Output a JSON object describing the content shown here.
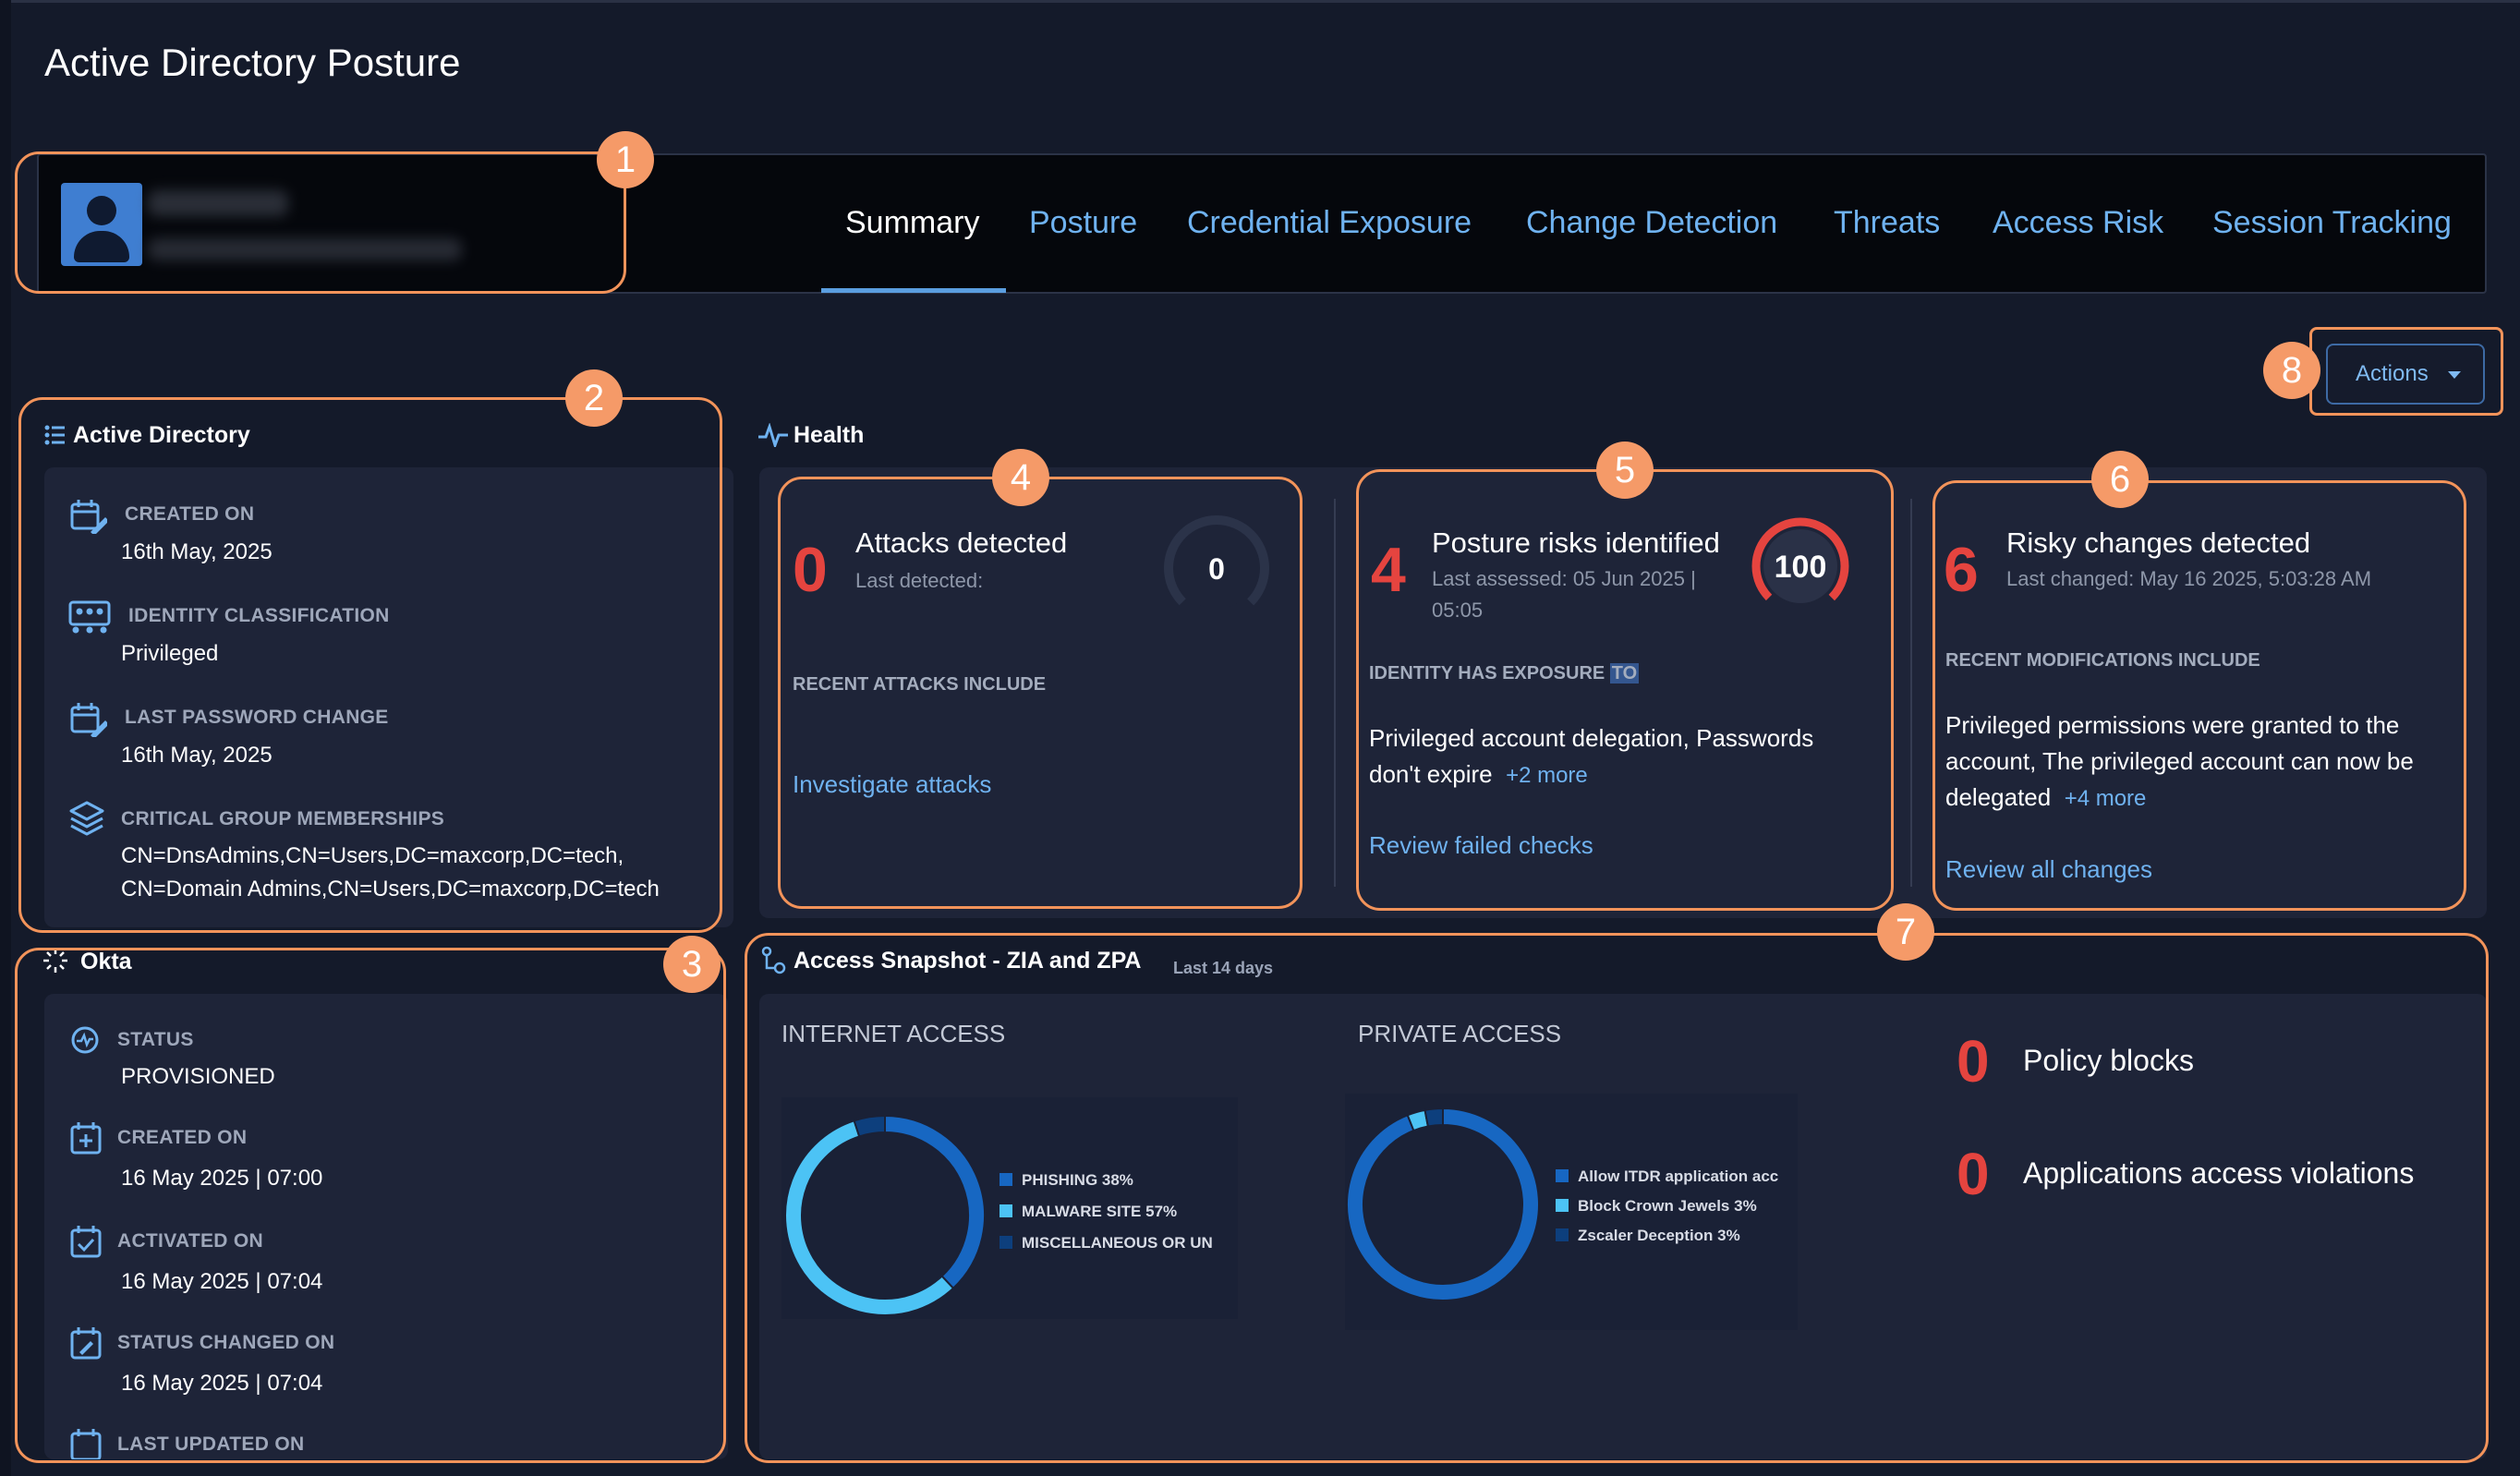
{
  "page": {
    "title": "Active Directory Posture"
  },
  "header": {
    "tabs": [
      {
        "label": "Summary",
        "active": true
      },
      {
        "label": "Posture"
      },
      {
        "label": "Credential Exposure"
      },
      {
        "label": "Change Detection"
      },
      {
        "label": "Threats"
      },
      {
        "label": "Access Risk"
      },
      {
        "label": "Session Tracking"
      }
    ]
  },
  "callouts": [
    "1",
    "2",
    "3",
    "4",
    "5",
    "6",
    "7",
    "8"
  ],
  "actions": {
    "label": "Actions"
  },
  "active_directory": {
    "title": "Active Directory",
    "fields": [
      {
        "label": "CREATED ON",
        "value": "16th May, 2025",
        "icon": "calendar-edit-icon"
      },
      {
        "label": "IDENTITY CLASSIFICATION",
        "value": "Privileged",
        "icon": "group-icon"
      },
      {
        "label": "LAST PASSWORD CHANGE",
        "value": "16th May, 2025",
        "icon": "calendar-edit-icon"
      },
      {
        "label": "CRITICAL GROUP MEMBERSHIPS",
        "value": "CN=DnsAdmins,CN=Users,DC=maxcorp,DC=tech, CN=Domain Admins,CN=Users,DC=maxcorp,DC=tech",
        "icon": "layers-icon"
      }
    ]
  },
  "okta": {
    "title": "Okta",
    "fields": [
      {
        "label": "STATUS",
        "value": "PROVISIONED",
        "icon": "status-icon"
      },
      {
        "label": "CREATED ON",
        "value": "16 May 2025 | 07:00",
        "icon": "calendar-plus-icon"
      },
      {
        "label": "ACTIVATED ON",
        "value": "16 May 2025 | 07:04",
        "icon": "calendar-check-icon"
      },
      {
        "label": "STATUS CHANGED ON",
        "value": "16 May 2025 | 07:04",
        "icon": "calendar-edit-icon"
      },
      {
        "label": "LAST UPDATED ON",
        "value": "",
        "icon": "calendar-icon"
      }
    ]
  },
  "health": {
    "title": "Health",
    "attacks": {
      "count": "0",
      "title": "Attacks detected",
      "sub": "Last detected:",
      "gauge": "0",
      "section": "RECENT ATTACKS INCLUDE",
      "link": "Investigate attacks"
    },
    "posture": {
      "count": "4",
      "title": "Posture risks identified",
      "sub1": "Last assessed: 05 Jun 2025 |",
      "sub2": "05:05",
      "gauge": "100",
      "section": "IDENTITY HAS EXPOSURE",
      "section_hl": "TO",
      "text": "Privileged account delegation,  Passwords don't expire",
      "more": "+2 more",
      "link": "Review failed checks"
    },
    "changes": {
      "count": "6",
      "title": "Risky changes detected",
      "sub": "Last changed: May 16 2025, 5:03:28 AM",
      "section": "RECENT MODIFICATIONS INCLUDE",
      "text": "Privileged permissions were granted to the account,  The privileged account can now be delegated",
      "more": "+4 more",
      "link": "Review all changes"
    }
  },
  "access": {
    "title": "Access Snapshot - ZIA and ZPA",
    "subtitle": "Last 14 days",
    "internet": {
      "heading": "INTERNET ACCESS",
      "legend": [
        {
          "label": "PHISHING 38%",
          "color": "#1767c2"
        },
        {
          "label": "MALWARE SITE 57%",
          "color": "#4cc3f5"
        },
        {
          "label": "MISCELLANEOUS OR UN",
          "color": "#0d3f7d"
        }
      ]
    },
    "private": {
      "heading": "PRIVATE ACCESS",
      "legend": [
        {
          "label": "Allow ITDR application acc",
          "color": "#1767c2"
        },
        {
          "label": "Block Crown Jewels 3%",
          "color": "#4cc3f5"
        },
        {
          "label": "Zscaler Deception 3%",
          "color": "#0d3f7d"
        }
      ]
    },
    "stats": [
      {
        "value": "0",
        "label": "Policy blocks"
      },
      {
        "value": "0",
        "label": "Applications access violations"
      }
    ]
  },
  "chart_data": [
    {
      "type": "pie",
      "title": "INTERNET ACCESS",
      "categories": [
        "PHISHING",
        "MALWARE SITE",
        "MISCELLANEOUS OR UN"
      ],
      "values": [
        38,
        57,
        5
      ]
    },
    {
      "type": "pie",
      "title": "PRIVATE ACCESS",
      "categories": [
        "Allow ITDR application acc",
        "Block Crown Jewels",
        "Zscaler Deception"
      ],
      "values": [
        94,
        3,
        3
      ]
    }
  ]
}
